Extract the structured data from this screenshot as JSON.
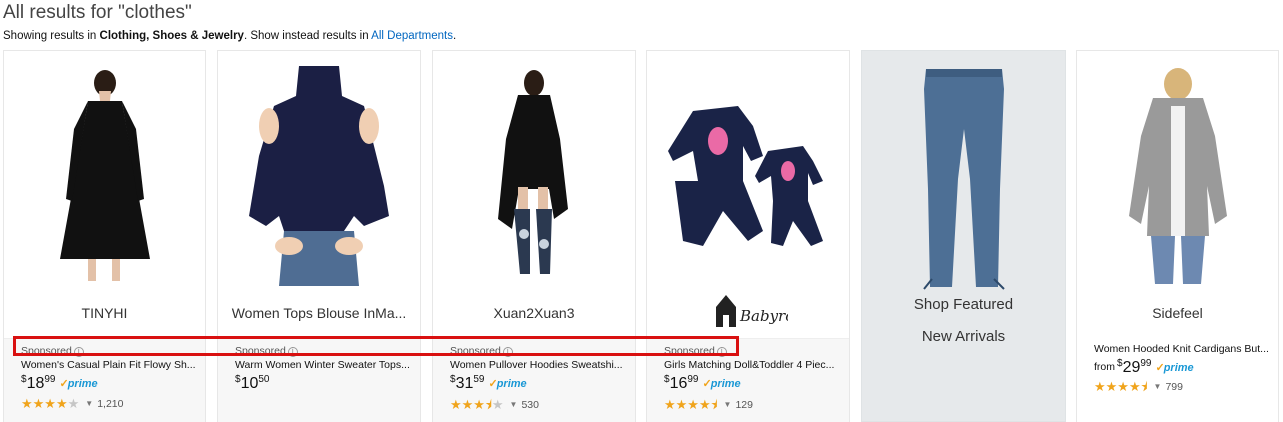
{
  "header": {
    "title": "All results for \"clothes\"",
    "showing_prefix": "Showing results in",
    "showing_category": "Clothing, Shoes & Jewelry",
    "instead_text": ". Show instead results in",
    "instead_link": "All Departments",
    "period": "."
  },
  "cards": [
    {
      "brand": "TINYHI",
      "sponsored": "Sponsored",
      "title": "Women's Casual Plain Fit Flowy Sh...",
      "price_currency": "$",
      "price_whole": "18",
      "price_fraction": "99",
      "prime": "prime",
      "rating": 4,
      "rating_count": "1,210"
    },
    {
      "brand": "Women Tops Blouse InMa...",
      "sponsored": "Sponsored",
      "title": "Warm Women Winter Sweater Tops...",
      "price_currency": "$",
      "price_whole": "10",
      "price_fraction": "50"
    },
    {
      "brand": "Xuan2Xuan3",
      "sponsored": "Sponsored",
      "title": "Women Pullover Hoodies Sweatshi...",
      "price_currency": "$",
      "price_whole": "31",
      "price_fraction": "59",
      "prime": "prime",
      "rating": 3.5,
      "rating_count": "530"
    },
    {
      "brand": "Babyroom",
      "sponsored": "Sponsored",
      "title": "Girls Matching Doll&Toddler 4 Piec...",
      "price_currency": "$",
      "price_whole": "16",
      "price_fraction": "99",
      "prime": "prime",
      "rating": 4.5,
      "rating_count": "129"
    },
    {
      "featured_line1": "Shop Featured",
      "featured_line2": "New Arrivals"
    },
    {
      "brand": "Sidefeel",
      "title": "Women Hooded Knit Cardigans But...",
      "price_from": "from",
      "price_currency": "$",
      "price_whole": "29",
      "price_fraction": "99",
      "prime": "prime",
      "rating": 4.5,
      "rating_count": "799"
    }
  ],
  "colors": {
    "link": "#0066c0",
    "star": "#f0a41c",
    "prime": "#1a98d5",
    "highlight": "#d91010",
    "featured_bg": "#e6e9eb"
  }
}
